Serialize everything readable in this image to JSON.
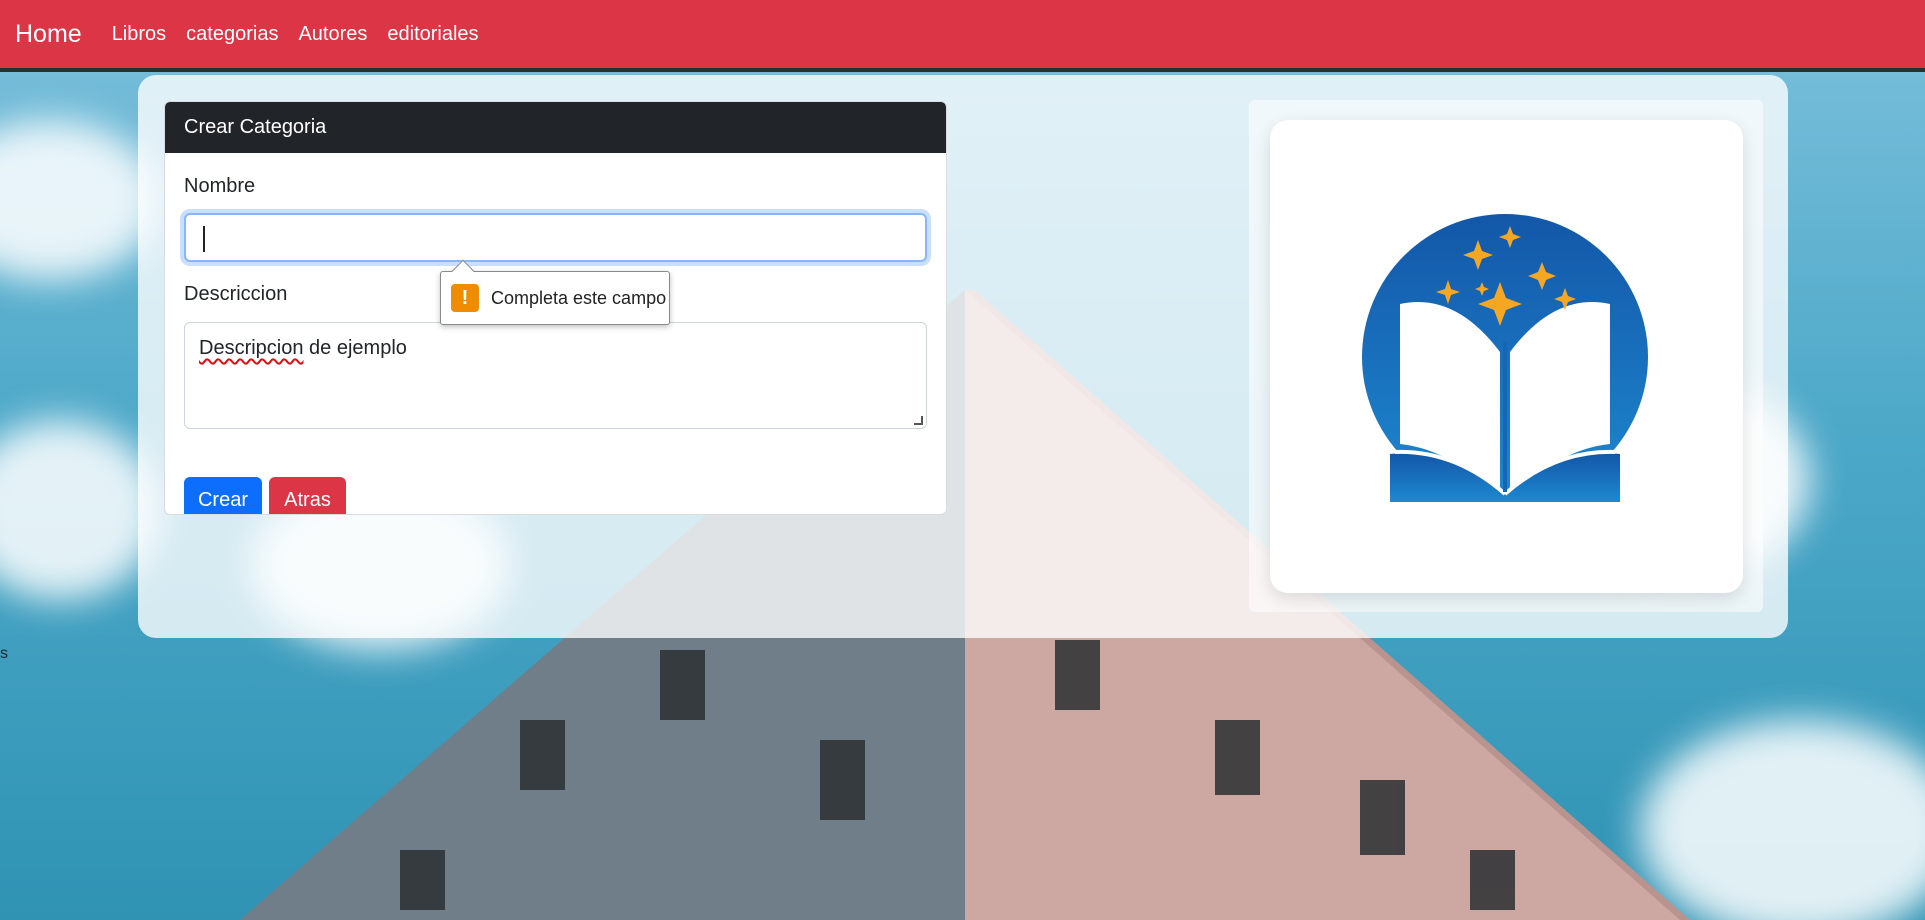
{
  "navbar": {
    "brand": "Home",
    "links": [
      "Libros",
      "categorias",
      "Autores",
      "editoriales"
    ]
  },
  "card": {
    "title": "Crear Categoria",
    "name_label": "Nombre",
    "name_value": "",
    "description_label": "Descriccion",
    "description_value": "Descripcion de ejemplo",
    "description_value_rest": " de ejemplo",
    "description_value_first": "Descripcion",
    "create_button": "Crear",
    "back_button": "Atras"
  },
  "validation_tooltip": {
    "icon": "warning-icon",
    "message": "Completa este campo"
  },
  "logo": {
    "icon": "open-book-with-stars-icon"
  },
  "stray_text": "s",
  "colors": {
    "navbar": "#dc3545",
    "card_header": "#212529",
    "primary_button": "#0d6efd",
    "danger_button": "#dc3545",
    "logo_blue": "#1565b8",
    "logo_star": "#f5a623"
  }
}
